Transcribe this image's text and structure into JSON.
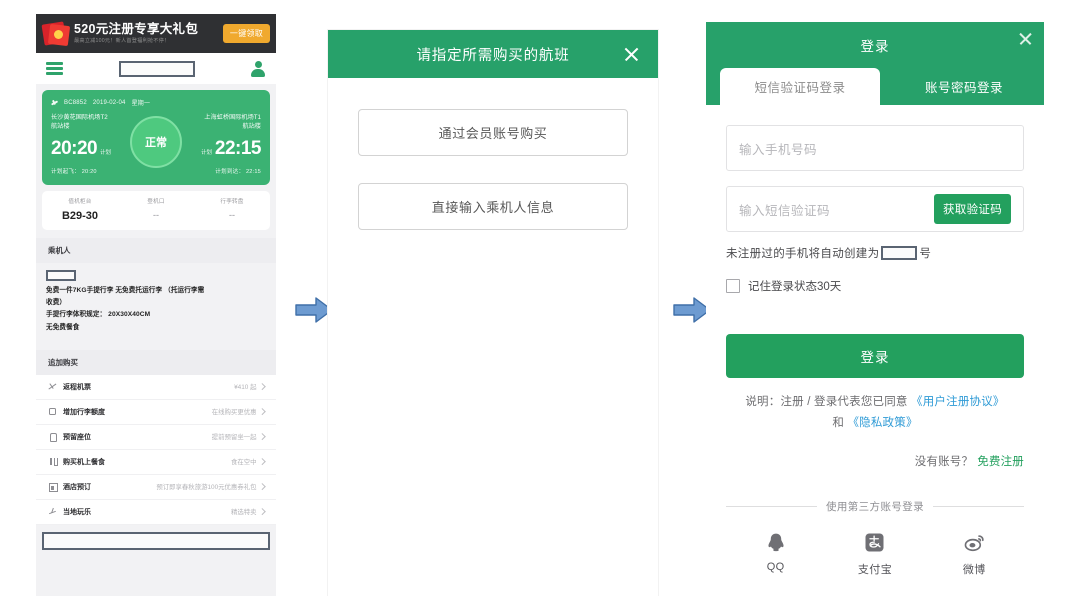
{
  "left_panel": {
    "banner": {
      "title": "520元注册专享大礼包",
      "subtitle": "最高立减100元！新人首登福利抢不停！",
      "button": "一键领取"
    },
    "appbar": {
      "menu_icon": "hamburger-menu-icon",
      "logo": "[redacted]",
      "profile_icon": "person-icon"
    },
    "flight_card": {
      "flight_no": "BC8852",
      "date": "2019-02-04",
      "weekday": "星期一",
      "dep_airport": "长沙黄花国际机场T2",
      "dep_terminal": "航站楼",
      "arr_airport": "上海虹桥国际机场T1",
      "arr_terminal": "航站楼",
      "dep_time": "20:20",
      "dep_time_tag": "计划",
      "arr_time": "22:15",
      "arr_time_tag": "计划",
      "dep_plan": "计划起飞： 20:20",
      "arr_plan": "计划到达： 22:15",
      "status": "正常"
    },
    "gate_info": {
      "labels": [
        "值机柜台",
        "登机口",
        "行李转盘"
      ],
      "values": [
        "B29-30",
        "--",
        "--"
      ]
    },
    "passenger_section": {
      "title": "乘机人",
      "name": "[redacted]"
    },
    "baggage_text": [
      "免费一件7KG手提行李 无免费托运行李 （托运行李需",
      "收费）",
      "手提行李体积规定： 20X30X40CM",
      "无免费餐食"
    ],
    "addon_section": {
      "title": "追加购买",
      "items": [
        {
          "icon": "return-flight-icon",
          "label": "返程机票",
          "right": "¥410 起"
        },
        {
          "icon": "baggage-icon",
          "label": "增加行李额度",
          "right": "在线购买更优惠"
        },
        {
          "icon": "seat-icon",
          "label": "预留座位",
          "right": "提前预留坐一起"
        },
        {
          "icon": "meal-icon",
          "label": "购买机上餐食",
          "right": "食在空中"
        },
        {
          "icon": "hotel-icon",
          "label": "酒店预订",
          "right": "预订即享春秋旅游100元优惠券礼包"
        },
        {
          "icon": "local-fun-icon",
          "label": "当地玩乐",
          "right": "精选特卖"
        }
      ]
    },
    "bottom_redact": "[redacted]"
  },
  "middle_panel": {
    "title": "请指定所需购买的航班",
    "close_icon": "close-icon",
    "options": [
      "通过会员账号购买",
      "直接输入乘机人信息"
    ]
  },
  "right_panel": {
    "title": "登录",
    "close_icon": "close-icon",
    "tabs": [
      {
        "label": "短信验证码登录",
        "active": true
      },
      {
        "label": "账号密码登录",
        "active": false
      }
    ],
    "phone_placeholder": "输入手机号码",
    "code_placeholder": "输入短信验证码",
    "code_button": "获取验证码",
    "hint_before": "未注册过的手机将自动创建为",
    "hint_redact": "[redacted]",
    "hint_after": "号",
    "remember_label": "记住登录状态30天",
    "submit": "登录",
    "terms_line1_prefix": "说明：注册 / 登录代表您已同意 ",
    "terms_link1": "《用户注册协议》",
    "terms_line2_prefix": "和 ",
    "terms_link2": "《隐私政策》",
    "no_account": "没有账号？",
    "register_link": "免费注册",
    "third_party_title": "使用第三方账号登录",
    "third_party": [
      {
        "icon": "qq-icon",
        "label": "QQ"
      },
      {
        "icon": "alipay-icon",
        "label": "支付宝"
      },
      {
        "icon": "weibo-icon",
        "label": "微博"
      }
    ]
  },
  "connectors": {
    "arrow1": "arrow-right-icon",
    "arrow2": "arrow-right-icon"
  },
  "colors": {
    "green": "#27a16a",
    "card_green": "#3bb273",
    "orange": "#f0a92e",
    "link_blue": "#2f9bd6",
    "arrow_blue": "#5b8fc9"
  }
}
